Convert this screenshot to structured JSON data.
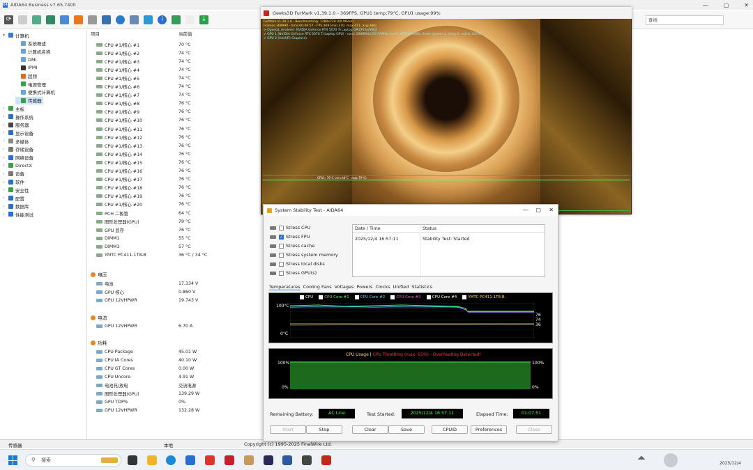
{
  "aida": {
    "title": "AIDA64 Business v7.65.7400",
    "search_placeholder": "查找",
    "win_minimize": "—",
    "win_maximize": "▢",
    "win_close": "✕",
    "tree": [
      {
        "label": "计算机",
        "indent": 1,
        "expander": "▾",
        "color": "#3a7bd5"
      },
      {
        "label": "系统概述",
        "indent": 2,
        "color": "#6aa0e0"
      },
      {
        "label": "计算机名称",
        "indent": 2,
        "color": "#6aa0e0"
      },
      {
        "label": "DMI",
        "indent": 2,
        "color": "#6aa0e0"
      },
      {
        "label": "IPMI",
        "indent": 2,
        "color": "#333333"
      },
      {
        "label": "超频",
        "indent": 2,
        "color": "#e06a1a"
      },
      {
        "label": "电源管理",
        "indent": 2,
        "color": "#3aa04a"
      },
      {
        "label": "便携式计算机",
        "indent": 2,
        "color": "#6aa0e0"
      },
      {
        "label": "传感器",
        "indent": 2,
        "color": "#3aa04a",
        "selected": true
      },
      {
        "label": "主板",
        "indent": 1,
        "expander": "›",
        "color": "#3aa04a"
      },
      {
        "label": "操作系统",
        "indent": 1,
        "expander": "›",
        "color": "#2a6fd0"
      },
      {
        "label": "服务器",
        "indent": 1,
        "expander": "›",
        "color": "#444444"
      },
      {
        "label": "显示设备",
        "indent": 1,
        "expander": "›",
        "color": "#2a6fd0"
      },
      {
        "label": "多媒体",
        "indent": 1,
        "expander": "›",
        "color": "#888888"
      },
      {
        "label": "存储设备",
        "indent": 1,
        "expander": "›",
        "color": "#777777"
      },
      {
        "label": "网络设备",
        "indent": 1,
        "expander": "›",
        "color": "#2a6fd0"
      },
      {
        "label": "DirectX",
        "indent": 1,
        "expander": "›",
        "color": "#3aa04a"
      },
      {
        "label": "设备",
        "indent": 1,
        "expander": "›",
        "color": "#777777"
      },
      {
        "label": "软件",
        "indent": 1,
        "expander": "›",
        "color": "#2a6fd0"
      },
      {
        "label": "安全性",
        "indent": 1,
        "expander": "›",
        "color": "#3aa04a"
      },
      {
        "label": "配置",
        "indent": 1,
        "expander": "›",
        "color": "#2a6fd0"
      },
      {
        "label": "数据库",
        "indent": 1,
        "expander": "›",
        "color": "#2a6fd0"
      },
      {
        "label": "性能测试",
        "indent": 1,
        "expander": "›",
        "color": "#2a6fd0"
      }
    ],
    "list_headers": {
      "item": "项目",
      "value": "当前值"
    },
    "temps": [
      {
        "n": "CPU #1/核心 #1",
        "v": "70 °C"
      },
      {
        "n": "CPU #1/核心 #2",
        "v": "74 °C"
      },
      {
        "n": "CPU #1/核心 #3",
        "v": "74 °C"
      },
      {
        "n": "CPU #1/核心 #4",
        "v": "74 °C"
      },
      {
        "n": "CPU #1/核心 #5",
        "v": "74 °C"
      },
      {
        "n": "CPU #1/核心 #6",
        "v": "74 °C"
      },
      {
        "n": "CPU #1/核心 #7",
        "v": "74 °C"
      },
      {
        "n": "CPU #1/核心 #8",
        "v": "76 °C"
      },
      {
        "n": "CPU #1/核心 #9",
        "v": "76 °C"
      },
      {
        "n": "CPU #1/核心 #10",
        "v": "76 °C"
      },
      {
        "n": "CPU #1/核心 #11",
        "v": "76 °C"
      },
      {
        "n": "CPU #1/核心 #12",
        "v": "76 °C"
      },
      {
        "n": "CPU #1/核心 #13",
        "v": "76 °C"
      },
      {
        "n": "CPU #1/核心 #14",
        "v": "76 °C"
      },
      {
        "n": "CPU #1/核心 #15",
        "v": "76 °C"
      },
      {
        "n": "CPU #1/核心 #16",
        "v": "76 °C"
      },
      {
        "n": "CPU #1/核心 #17",
        "v": "76 °C"
      },
      {
        "n": "CPU #1/核心 #18",
        "v": "76 °C"
      },
      {
        "n": "CPU #1/核心 #19",
        "v": "76 °C"
      },
      {
        "n": "CPU #1/核心 #20",
        "v": "76 °C"
      },
      {
        "n": "PCH 二极管",
        "v": "64 °C"
      },
      {
        "n": "图形处理器(GPU)",
        "v": "79 °C"
      },
      {
        "n": "GPU 显存",
        "v": "76 °C"
      },
      {
        "n": "DIMM1",
        "v": "55 °C"
      },
      {
        "n": "DIMM3",
        "v": "57 °C"
      },
      {
        "n": "YMTC PC411-1T8-B",
        "v": "36 °C / 34 °C"
      }
    ],
    "volt_title": "电压",
    "volts": [
      {
        "n": "电池",
        "v": "17.334 V"
      },
      {
        "n": "GPU 核心",
        "v": "0.860 V"
      },
      {
        "n": "GPU 12VHPWR",
        "v": "19.743 V"
      }
    ],
    "curr_title": "电流",
    "currs": [
      {
        "n": "GPU 12VHPWR",
        "v": "6.70 A"
      }
    ],
    "power_title": "功耗",
    "powers": [
      {
        "n": "CPU Package",
        "v": "45.01 W"
      },
      {
        "n": "CPU IA Cores",
        "v": "40.10 W"
      },
      {
        "n": "CPU GT Cores",
        "v": "0.00 W"
      },
      {
        "n": "CPU Uncore",
        "v": "4.91 W"
      },
      {
        "n": "电池充/放电",
        "v": "交流电源"
      },
      {
        "n": "图形处理器(GPU)",
        "v": "139.29 W"
      },
      {
        "n": "GPU TDP%",
        "v": "0%"
      },
      {
        "n": "GPU 12VHPWR",
        "v": "132.28 W"
      }
    ],
    "status": {
      "left": "传感器",
      "mid": "本地",
      "copyright": "Copyright (c) 1995-2025 FinalWire Ltd."
    }
  },
  "furmark": {
    "title": "Geeks3D FurMark v1.39.1.0 - 369FPS, GPU1 temp:79°C, GPU1 usage:99%",
    "overlay_line1": "FurMark v1.39.1.0 - Benchmarking: 1280x720 (0X MSAA)",
    "overlay_line2": "Frames:369998 - time:00:09:57 - FPS:369 (min:370, max:411, avg:386)",
    "overlay_line3": "> OpenGL renderer: NVIDIA GeForce RTX 5070 Ti Laptop GPU/PCIe/SSE2",
    "overlay_line4": "> GPU 1 (NVIDIA GeForce RTX 5070 Ti Laptop GPU) - core: 2088MHz/79°C/99%, mem: 8001MHz/9%, limits:[power:1, temp:0, volt:0, OV:0]",
    "overlay_line5": "> GPU 2 (Intel(R) Graphics)",
    "graph_label": "GPU1: 79°C (min:48°C - max:79°C)"
  },
  "stability": {
    "title": "System Stability Test - AIDA64",
    "checks": [
      {
        "label": "Stress CPU",
        "on": false
      },
      {
        "label": "Stress FPU",
        "on": true
      },
      {
        "label": "Stress cache",
        "on": false
      },
      {
        "label": "Stress system memory",
        "on": false
      },
      {
        "label": "Stress local disks",
        "on": false
      },
      {
        "label": "Stress GPU(s)",
        "on": false
      }
    ],
    "log_headers": {
      "date": "Date / Time",
      "status": "Status"
    },
    "log_row": {
      "date": "2025/12/4 16:57:11",
      "status": "Stability Test: Started"
    },
    "tabs": [
      "Temperatures",
      "Cooling Fans",
      "Voltages",
      "Powers",
      "Clocks",
      "Unified",
      "Statistics"
    ],
    "legend": [
      {
        "label": "CPU",
        "color": "#ffffff"
      },
      {
        "label": "CPU Core #1",
        "color": "#44ff44"
      },
      {
        "label": "CPU Core #2",
        "color": "#44ddff"
      },
      {
        "label": "CPU Core #3",
        "color": "#ff44ff"
      },
      {
        "label": "CPU Core #4",
        "color": "#ffffff"
      },
      {
        "label": "YMTC PC411-1T8-B",
        "color": "#ffdd44"
      }
    ],
    "temp_graph": {
      "top": "100°C",
      "bottom": "0°C",
      "r1": "76",
      "r2": "74",
      "r3": "36"
    },
    "usage_graph": {
      "title1": "CPU Usage",
      "sep": "|",
      "title2": "CPU Throttling (max: 65%) - Overheating Detected!",
      "top": "100%",
      "bottom": "0%",
      "rtop": "100%",
      "rbottom": "0%"
    },
    "remaining_label": "Remaining Battery:",
    "remaining_value": "AC Line",
    "started_label": "Test Started:",
    "started_value": "2025/12/4 16:57:11",
    "elapsed_label": "Elapsed Time:",
    "elapsed_value": "01:07:51",
    "buttons": [
      "Start",
      "Stop",
      "Clear",
      "Save",
      "CPUID",
      "Preferences",
      "Close"
    ]
  },
  "taskbar": {
    "search": "搜索",
    "date": "2025/12/4"
  }
}
